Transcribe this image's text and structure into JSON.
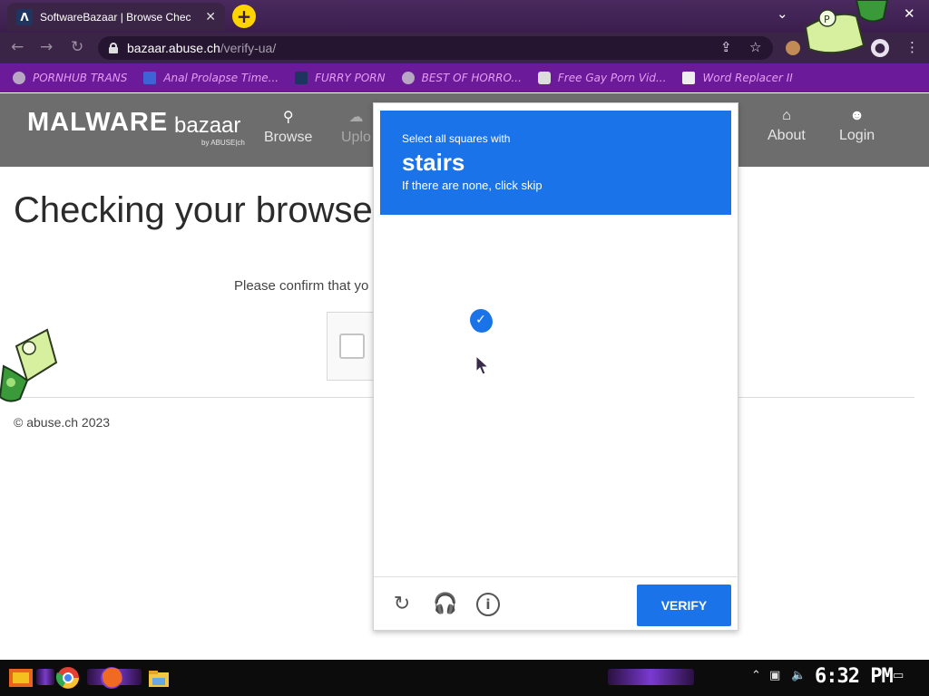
{
  "browser": {
    "tab": {
      "title": "SoftwareBazaar | Browse Chec",
      "favicon": "abuse-logo-icon"
    },
    "url": {
      "host": "bazaar.abuse.ch",
      "path": "/verify-ua/"
    },
    "bookmarks": [
      {
        "label": "PORNHUB TRANS",
        "icon": "globe-icon"
      },
      {
        "label": "Anal Prolapse Time...",
        "icon": "bookmark-square-icon"
      },
      {
        "label": "FURRY PORN",
        "icon": "abuse-logo-icon"
      },
      {
        "label": "BEST OF HORRO...",
        "icon": "globe-icon"
      },
      {
        "label": "Free Gay Porn Vid...",
        "icon": "puzzle-icon"
      },
      {
        "label": "Word Replacer II",
        "icon": "wr-icon"
      }
    ]
  },
  "site": {
    "logo_main": "MALWARE",
    "logo_sub": "bazaar",
    "logo_by": "by ABUSE|ch",
    "nav": [
      {
        "label": "Browse",
        "icon": "search-icon"
      },
      {
        "label": "Uplo",
        "icon": "upload-cloud-icon"
      },
      {
        "label": "About",
        "icon": "building-icon"
      },
      {
        "label": "Login",
        "icon": "user-icon"
      }
    ],
    "heading": "Checking your browser",
    "confirm_text": "Please confirm that yo",
    "footer": "© abuse.ch 2023"
  },
  "captcha": {
    "prompt_line1": "Select all squares with",
    "prompt_keyword": "stairs",
    "prompt_line3": "If there are none, click skip",
    "selected_tiles": [
      5
    ],
    "verify_label": "VERIFY"
  },
  "taskbar": {
    "clock": "6:32 PM",
    "apps": [
      "start-icon",
      "chrome-icon",
      "firefox-icon",
      "file-explorer-icon"
    ]
  },
  "colors": {
    "accent": "#1a73e8",
    "chrome_bg": "#3a2546",
    "bookmarks_bg": "#6b1a9a",
    "site_header": "#6d6d6d"
  }
}
